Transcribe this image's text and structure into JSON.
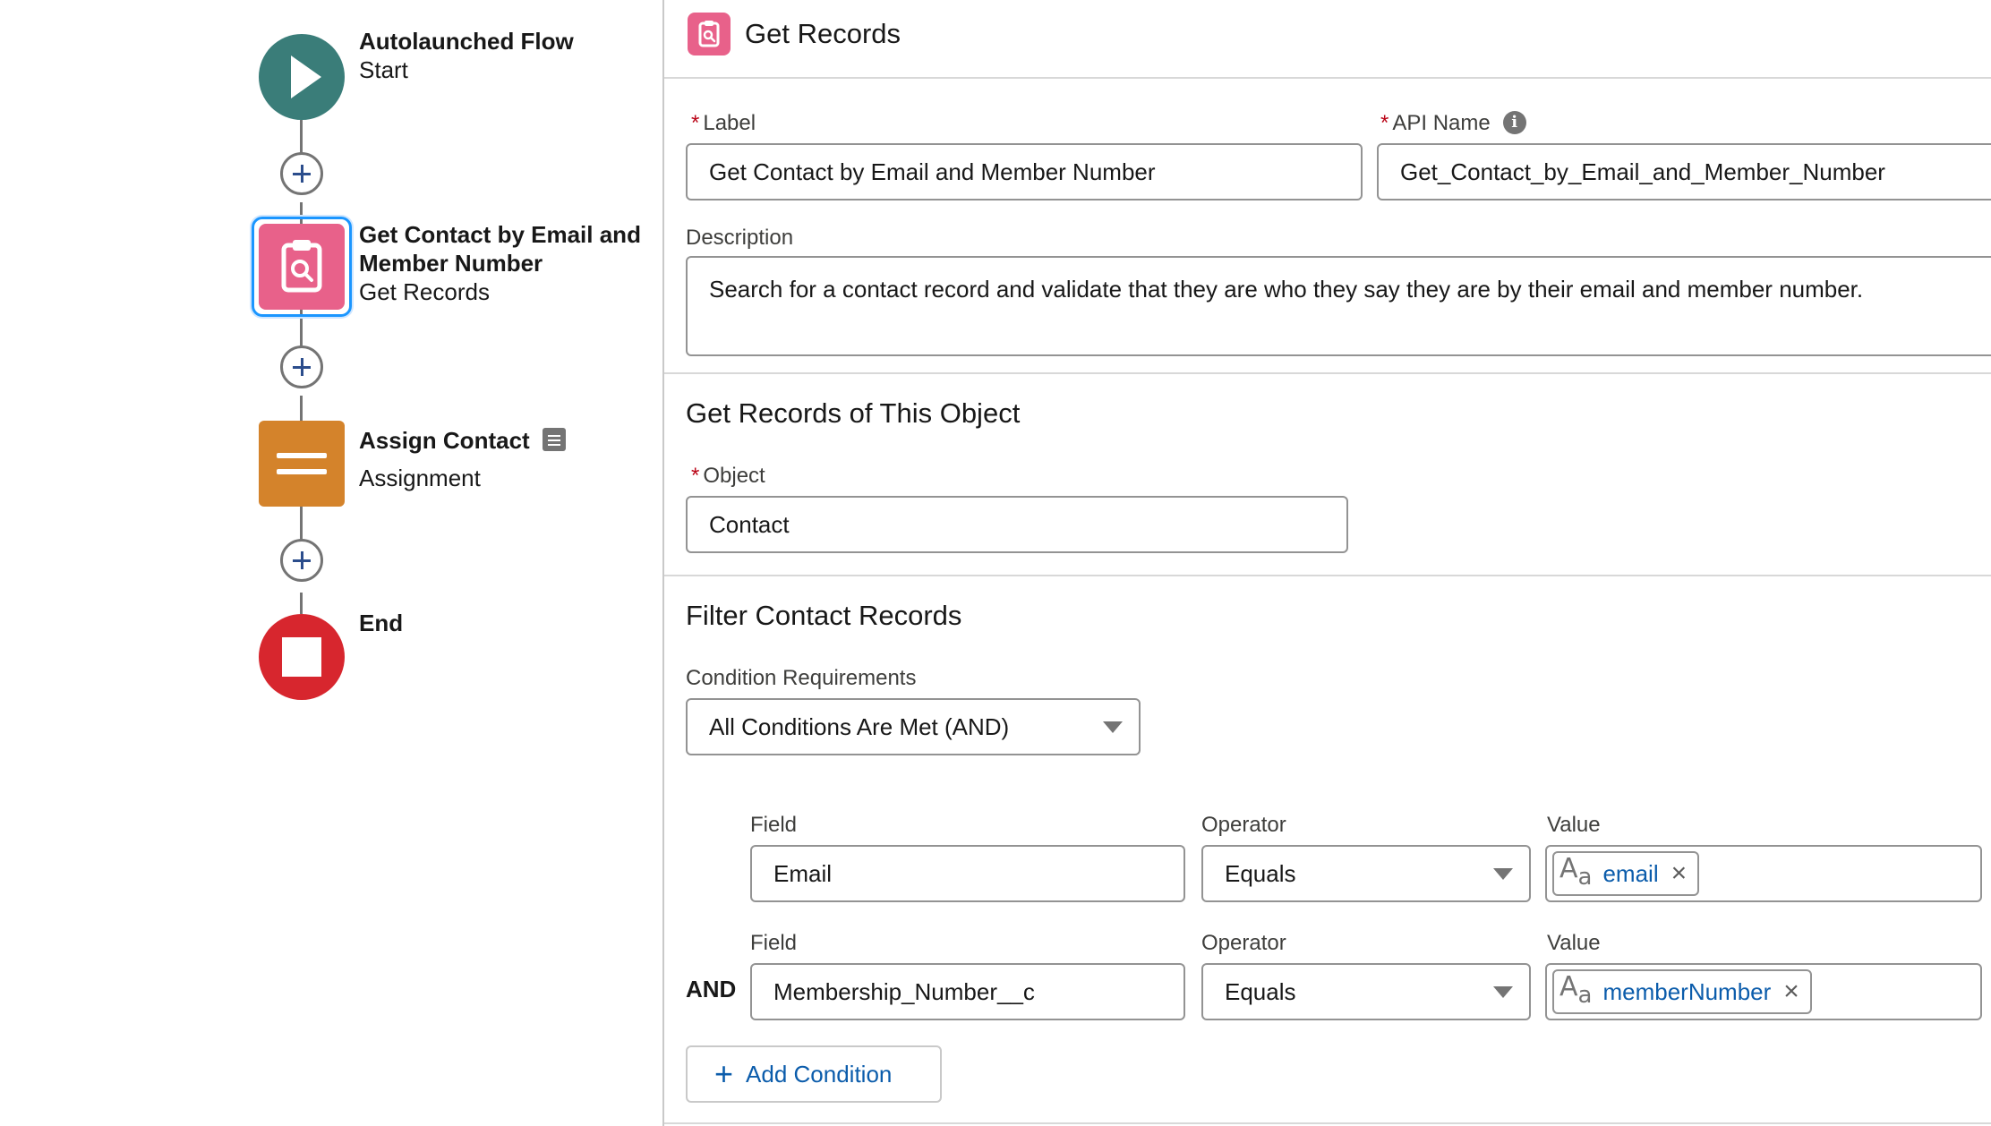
{
  "canvas": {
    "start": {
      "title": "Autolaunched Flow",
      "subtitle": "Start"
    },
    "get_records": {
      "title_line1": "Get Contact by Email and",
      "title_line2": "Member Number",
      "subtitle": "Get Records"
    },
    "assignment": {
      "title": "Assign Contact",
      "subtitle": "Assignment"
    },
    "end": {
      "title": "End"
    }
  },
  "panel": {
    "header_title": "Get Records",
    "label_field": {
      "label": "Label",
      "value": "Get Contact by Email and Member Number"
    },
    "api_name_field": {
      "label": "API Name",
      "value": "Get_Contact_by_Email_and_Member_Number"
    },
    "description_field": {
      "label": "Description",
      "value": "Search for a contact record and validate that they are who they say they are by their email and member number."
    },
    "object_section": {
      "title": "Get Records of This Object",
      "object_label": "Object",
      "object_value": "Contact"
    },
    "filter_section": {
      "title": "Filter Contact Records",
      "condition_label": "Condition Requirements",
      "condition_value": "All Conditions Are Met (AND)",
      "conditions": [
        {
          "field_label": "Field",
          "field_value": "Email",
          "operator_label": "Operator",
          "operator_value": "Equals",
          "value_label": "Value",
          "value_pill": "email",
          "logic": ""
        },
        {
          "field_label": "Field",
          "field_value": "Membership_Number__c",
          "operator_label": "Operator",
          "operator_value": "Equals",
          "value_label": "Value",
          "value_pill": "memberNumber",
          "logic": "AND"
        }
      ],
      "add_condition_label": "Add Condition"
    }
  },
  "colors": {
    "start_node": "#3a7d79",
    "get_records_node": "#e8618a",
    "assignment_node": "#d4832b",
    "end_node": "#d7262e",
    "selection": "#1b96ff",
    "link_blue": "#0b5cab",
    "required": "#ba0517"
  },
  "icons": [
    "play-icon",
    "clipboard-search-icon",
    "equals-icon",
    "stop-icon",
    "add-element-icon",
    "info-icon",
    "text-resource-icon",
    "remove-icon",
    "dropdown-arrow-icon",
    "description-icon",
    "plus-icon"
  ]
}
